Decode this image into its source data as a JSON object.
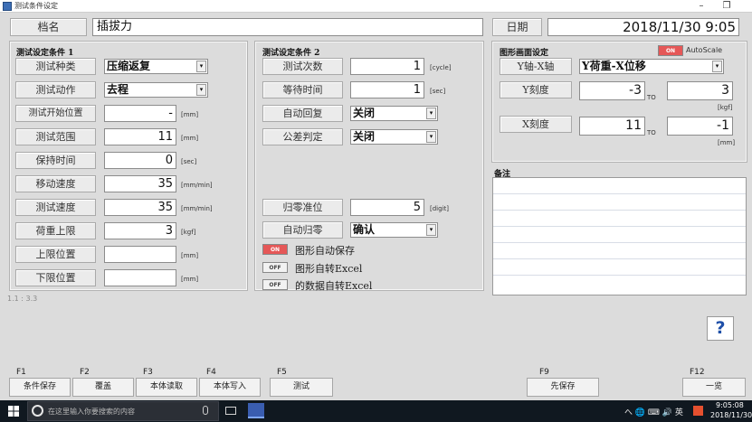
{
  "window": {
    "title": "测试条件设定",
    "minimize": "–",
    "restore": "❐"
  },
  "header": {
    "name_label": "档名",
    "name_value": "插拔力",
    "date_label": "日期",
    "date_value": "2018/11/30 9:05"
  },
  "cond1": {
    "title": "测试设定条件 1",
    "rows": [
      {
        "label": "测试种类",
        "value": "压缩返复",
        "type": "combo"
      },
      {
        "label": "测试动作",
        "value": "去程",
        "type": "combo"
      },
      {
        "label": "测试开始位置",
        "value": "-",
        "unit": "[mm]",
        "type": "num"
      },
      {
        "label": "测试范围",
        "value": "11",
        "unit": "[mm]",
        "type": "num"
      },
      {
        "label": "保持时间",
        "value": "0",
        "unit": "[sec]",
        "type": "num"
      },
      {
        "label": "移动速度",
        "value": "35",
        "unit": "[mm/min]",
        "type": "num"
      },
      {
        "label": "测试速度",
        "value": "35",
        "unit": "[mm/min]",
        "type": "num"
      },
      {
        "label": "荷重上限",
        "value": "3",
        "unit": "[kgf]",
        "type": "num"
      },
      {
        "label": "上限位置",
        "value": "",
        "unit": "[mm]",
        "type": "num"
      },
      {
        "label": "下限位置",
        "value": "",
        "unit": "[mm]",
        "type": "num"
      }
    ]
  },
  "cond2": {
    "title": "测试设定条件 2",
    "rows": [
      {
        "label": "测试次数",
        "value": "1",
        "unit": "[cycle]",
        "type": "num"
      },
      {
        "label": "等待时间",
        "value": "1",
        "unit": "[sec]",
        "type": "num"
      },
      {
        "label": "自动回复",
        "value": "关闭",
        "type": "combo"
      },
      {
        "label": "公差判定",
        "value": "关闭",
        "type": "combo"
      }
    ],
    "zero_label": "归零准位",
    "zero_value": "5",
    "zero_unit": "[digit]",
    "autozero_label": "自动归零",
    "autozero_value": "确认",
    "toggles": [
      {
        "state": "ON",
        "label": "图形自动保存"
      },
      {
        "state": "OFF",
        "label": "图形自转Excel"
      },
      {
        "state": "OFF",
        "label": "的数据自转Excel"
      }
    ]
  },
  "graph": {
    "title": "图形画面设定",
    "autoscale_state": "ON",
    "autoscale_label": "AutoScale",
    "axis_label": "Y轴-X轴",
    "axis_value": "Y荷重-X位移",
    "y_label": "Y刻度",
    "y_from": "-3",
    "to_y": "TO",
    "y_to": "3",
    "y_unit": "[kgf]",
    "x_label": "X刻度",
    "x_from": "11",
    "to_x": "TO",
    "x_to": "-1",
    "x_unit": "[mm]"
  },
  "notes": {
    "title": "备注"
  },
  "version": "1.1 : 3.3",
  "help": "?",
  "fkeys": [
    {
      "key": "F1",
      "label": "条件保存"
    },
    {
      "key": "F2",
      "label": "覆盖"
    },
    {
      "key": "F3",
      "label": "本体读取"
    },
    {
      "key": "F4",
      "label": "本体写入"
    },
    {
      "key": "F5",
      "label": "测试"
    },
    {
      "key": "F9",
      "label": "先保存"
    },
    {
      "key": "F12",
      "label": "一览"
    }
  ],
  "taskbar": {
    "search_placeholder": "在这里输入你要搜索的内容",
    "tray": "へ 🌐 ⌨ 🔊 英",
    "time": "9:05:08",
    "date": "2018/11/30"
  },
  "colors": {
    "toggle_on": "#e55757",
    "help_text": "#1e4fa8",
    "taskbar": "#101820"
  }
}
